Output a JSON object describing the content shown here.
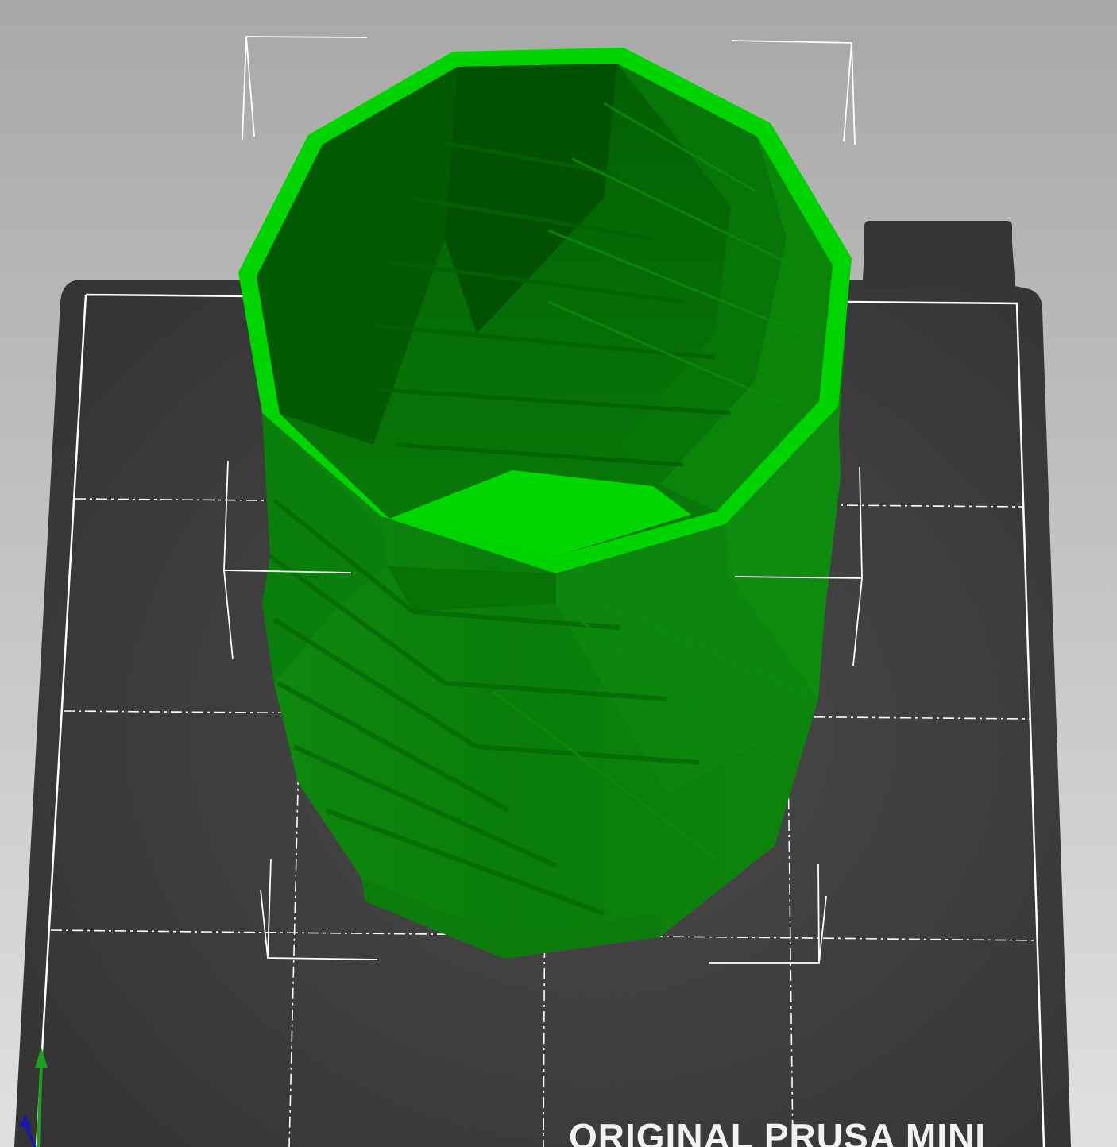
{
  "scene": {
    "printer_bed_label": "ORIGINAL PRUSA MINI",
    "background_top": "#a9a9a9",
    "background_bottom": "#dedede",
    "bed_color": "#3a3a3a",
    "object_color": "#149c14",
    "object_highlight": "#00d400",
    "selection_box_color": "#ffffff",
    "gridline_color": "#ffffff",
    "axis_colors": {
      "x": "#d42a2a",
      "y": "#1f9e1f",
      "z": "#1a1aa8"
    }
  }
}
